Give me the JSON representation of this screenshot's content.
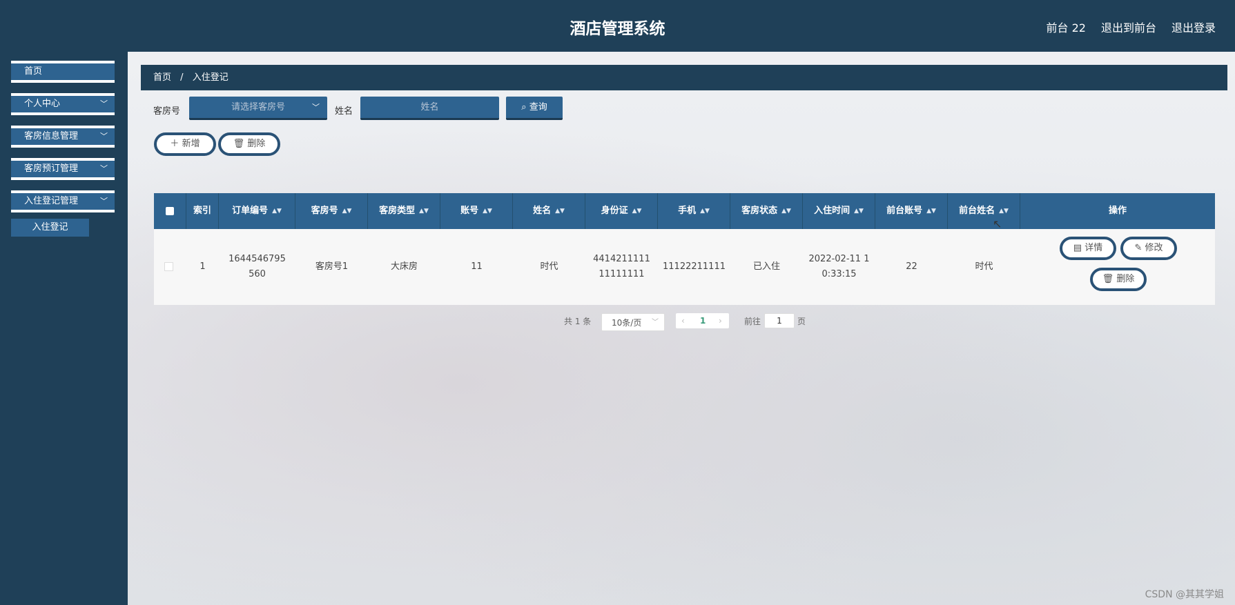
{
  "header": {
    "title": "酒店管理系统",
    "links": [
      "前台 22",
      "退出到前台",
      "退出登录"
    ]
  },
  "sidebar": {
    "items": [
      {
        "label": "首页",
        "has_children": false
      },
      {
        "label": "个人中心",
        "has_children": true
      },
      {
        "label": "客房信息管理",
        "has_children": true
      },
      {
        "label": "客房预订管理",
        "has_children": true
      },
      {
        "label": "入住登记管理",
        "has_children": true
      }
    ],
    "sub_item": "入住登记"
  },
  "breadcrumb": {
    "home": "首页",
    "separator": "/",
    "current": "入住登记"
  },
  "search": {
    "room_label": "客房号",
    "room_placeholder": "请选择客房号",
    "name_label": "姓名",
    "name_placeholder": "姓名",
    "query_button": "查询"
  },
  "actions": {
    "add": "新增",
    "delete": "删除"
  },
  "table": {
    "headers": [
      "索引",
      "订单编号",
      "客房号",
      "客房类型",
      "账号",
      "姓名",
      "身份证",
      "手机",
      "客房状态",
      "入住时间",
      "前台账号",
      "前台姓名",
      "操作"
    ],
    "rows": [
      {
        "index": "1",
        "order_no": "1644546795560",
        "room_no": "客房号1",
        "room_type": "大床房",
        "account": "11",
        "name": "时代",
        "id_card": "441421111111111111",
        "phone": "11122211111",
        "status": "已入住",
        "checkin_time": "2022-02-11 10:33:15",
        "desk_account": "22",
        "desk_name": "时代",
        "ops": [
          "详情",
          "修改",
          "删除"
        ]
      }
    ]
  },
  "pagination": {
    "total_text": "共 1 条",
    "page_size": "10条/页",
    "current_page": "1",
    "goto_label": "前往",
    "goto_value": "1",
    "page_unit": "页"
  },
  "watermark": "CSDN @其其学姐",
  "colors": {
    "primary": "#2e6390",
    "dark": "#1f4058",
    "accent": "#3a9b7a"
  }
}
